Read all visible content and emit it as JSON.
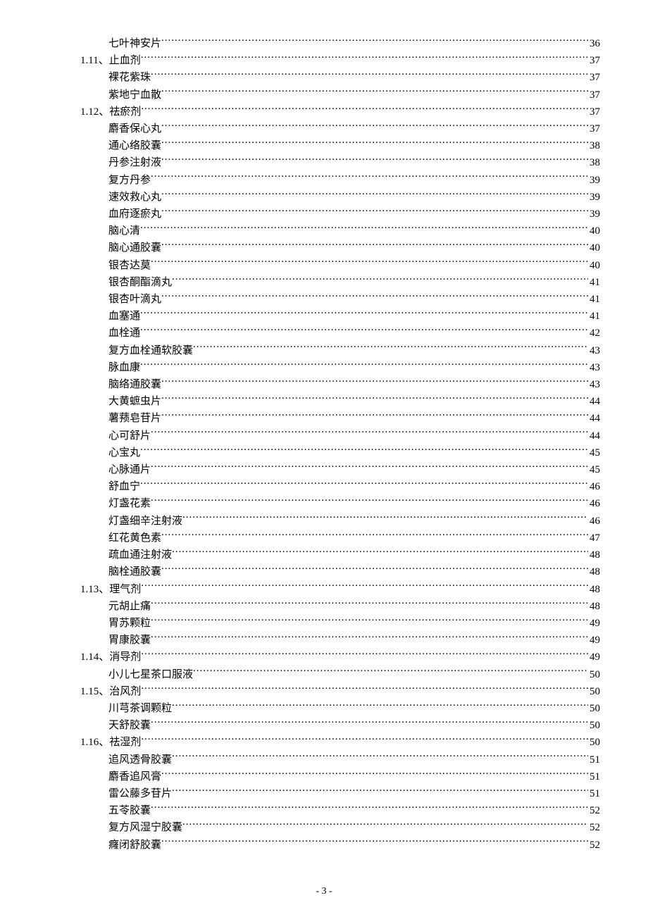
{
  "toc": [
    {
      "level": 3,
      "title": "七叶神安片",
      "page": "36"
    },
    {
      "level": 2,
      "title": "1.11、止血剂",
      "page": "37"
    },
    {
      "level": 3,
      "title": "裸花紫珠",
      "page": "37"
    },
    {
      "level": 3,
      "title": "紫地宁血散",
      "page": "37"
    },
    {
      "level": 2,
      "title": "1.12、祛瘀剂",
      "page": "37"
    },
    {
      "level": 3,
      "title": "麝香保心丸",
      "page": "37"
    },
    {
      "level": 3,
      "title": "通心络胶囊",
      "page": "38"
    },
    {
      "level": 3,
      "title": "丹参注射液",
      "page": "38"
    },
    {
      "level": 3,
      "title": "复方丹参",
      "page": "39"
    },
    {
      "level": 3,
      "title": "速效救心丸",
      "page": "39"
    },
    {
      "level": 3,
      "title": "血府逐瘀丸",
      "page": "39"
    },
    {
      "level": 3,
      "title": "脑心清",
      "page": "40"
    },
    {
      "level": 3,
      "title": "脑心通胶囊",
      "page": "40"
    },
    {
      "level": 3,
      "title": "银杏达莫",
      "page": "40"
    },
    {
      "level": 3,
      "title": "银杏酮酯滴丸",
      "page": "41"
    },
    {
      "level": 3,
      "title": "银杏叶滴丸",
      "page": "41"
    },
    {
      "level": 3,
      "title": "血塞通",
      "page": "41"
    },
    {
      "level": 3,
      "title": "血栓通",
      "page": "42"
    },
    {
      "level": 3,
      "title": "复方血栓通软胶囊",
      "page": "43"
    },
    {
      "level": 3,
      "title": "脉血康",
      "page": "43"
    },
    {
      "level": 3,
      "title": "脑络通胶囊",
      "page": "43"
    },
    {
      "level": 3,
      "title": "大黄蟅虫片",
      "page": "44"
    },
    {
      "level": 3,
      "title": "薯蓣皂苷片",
      "page": "44"
    },
    {
      "level": 3,
      "title": "心可舒片",
      "page": "44"
    },
    {
      "level": 3,
      "title": "心宝丸",
      "page": "45"
    },
    {
      "level": 3,
      "title": "心脉通片",
      "page": "45"
    },
    {
      "level": 3,
      "title": "舒血宁",
      "page": "46"
    },
    {
      "level": 3,
      "title": "灯盏花素",
      "page": "46"
    },
    {
      "level": 3,
      "title": "灯盏细辛注射液",
      "page": "46"
    },
    {
      "level": 3,
      "title": "红花黄色素",
      "page": "47"
    },
    {
      "level": 3,
      "title": "疏血通注射液",
      "page": "48"
    },
    {
      "level": 3,
      "title": "脑栓通胶囊",
      "page": "48"
    },
    {
      "level": 2,
      "title": "1.13、理气剂",
      "page": "48"
    },
    {
      "level": 3,
      "title": "元胡止痛",
      "page": "48"
    },
    {
      "level": 3,
      "title": "胃苏颗粒",
      "page": "49"
    },
    {
      "level": 3,
      "title": "胃康胶囊",
      "page": "49"
    },
    {
      "level": 2,
      "title": "1.14、消导剂",
      "page": "49"
    },
    {
      "level": 3,
      "title": "小儿七星茶口服液",
      "page": "50"
    },
    {
      "level": 2,
      "title": "1.15、治风剂",
      "page": "50"
    },
    {
      "level": 3,
      "title": "川芎茶调颗粒",
      "page": "50"
    },
    {
      "level": 3,
      "title": "天舒胶囊",
      "page": "50"
    },
    {
      "level": 2,
      "title": "1.16、祛湿剂",
      "page": "50"
    },
    {
      "level": 3,
      "title": "追风透骨胶囊",
      "page": "51"
    },
    {
      "level": 3,
      "title": "麝香追风膏",
      "page": "51"
    },
    {
      "level": 3,
      "title": "雷公藤多苷片",
      "page": "51"
    },
    {
      "level": 3,
      "title": "五苓胶囊",
      "page": "52"
    },
    {
      "level": 3,
      "title": "复方风湿宁胶囊",
      "page": "52"
    },
    {
      "level": 3,
      "title": "癃闭舒胶囊",
      "page": "52"
    }
  ],
  "footer": {
    "page_indicator": "- 3 -"
  }
}
